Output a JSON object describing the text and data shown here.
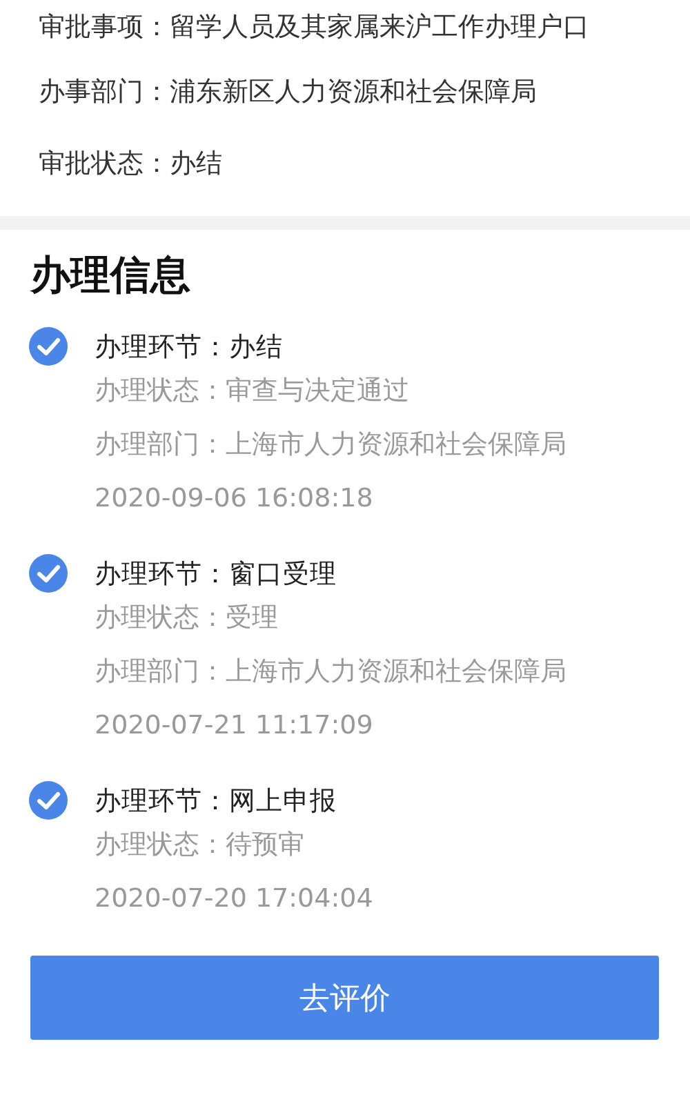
{
  "approval_info": [
    "审批事项：留学人员及其家属来沪工作办理户口",
    "办事部门：浦东新区人力资源和社会保障局",
    "审批状态：办结"
  ],
  "section_title": "办理信息",
  "steps": [
    {
      "checked": true,
      "title": "办理环节：办结",
      "details": [
        "办理状态：审查与决定通过",
        "办理部门：上海市人力资源和社会保障局"
      ],
      "time": "2020-09-06 16:08:18"
    },
    {
      "checked": true,
      "title": "办理环节：窗口受理",
      "details": [
        "办理状态：受理",
        "办理部门：上海市人力资源和社会保障局"
      ],
      "time": "2020-07-21 11:17:09"
    },
    {
      "checked": true,
      "title": "办理环节：网上申报",
      "details": [
        "办理状态：待预审"
      ],
      "time": "2020-07-20 17:04:04"
    }
  ],
  "button": "去评价"
}
